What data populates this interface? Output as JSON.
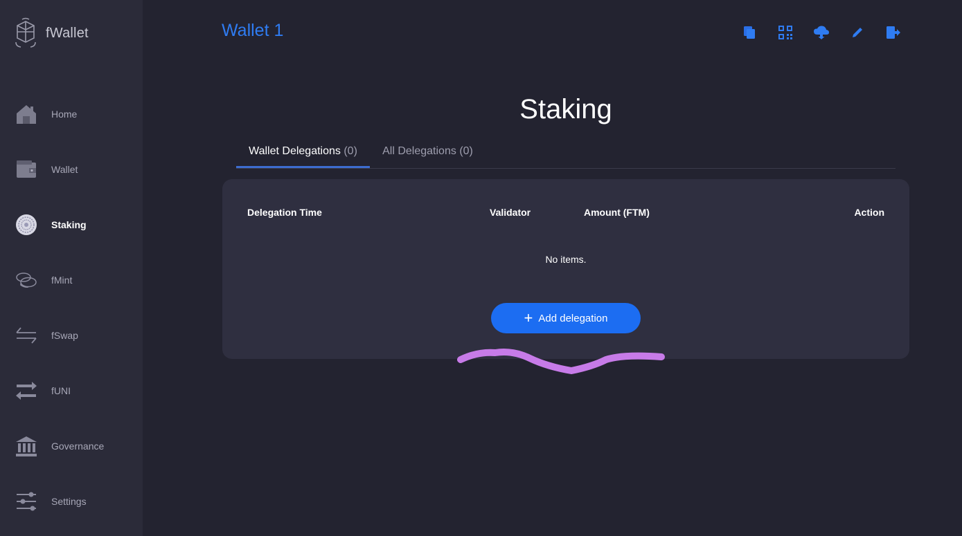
{
  "app": {
    "name": "fWallet"
  },
  "sidebar": {
    "items": [
      {
        "label": "Home",
        "icon": "home-icon"
      },
      {
        "label": "Wallet",
        "icon": "wallet-icon"
      },
      {
        "label": "Staking",
        "icon": "staking-icon",
        "active": true
      },
      {
        "label": "fMint",
        "icon": "coins-icon"
      },
      {
        "label": "fSwap",
        "icon": "swap-icon"
      },
      {
        "label": "fUNI",
        "icon": "exchange-icon"
      },
      {
        "label": "Governance",
        "icon": "bank-icon"
      },
      {
        "label": "Settings",
        "icon": "sliders-icon"
      }
    ]
  },
  "header": {
    "wallet_name": "Wallet 1",
    "icons": [
      "copy-icon",
      "qr-code-icon",
      "cloud-download-icon",
      "pencil-icon",
      "logout-icon"
    ]
  },
  "main": {
    "title": "Staking",
    "tabs": [
      {
        "label": "Wallet Delegations",
        "count": "(0)"
      },
      {
        "label": "All Delegations",
        "count": "(0)"
      }
    ],
    "table": {
      "columns": [
        "Delegation Time",
        "Validator",
        "Amount (FTM)",
        "Action"
      ],
      "empty_text": "No items."
    },
    "add_button": {
      "icon": "+",
      "label": "Add delegation"
    }
  },
  "colors": {
    "accent": "#2f7cf2",
    "button": "#1c6df2",
    "sidebar_bg": "#2b2b39",
    "page_bg": "#232330",
    "card_bg": "#2f2f40",
    "annotation": "#c77be8"
  }
}
